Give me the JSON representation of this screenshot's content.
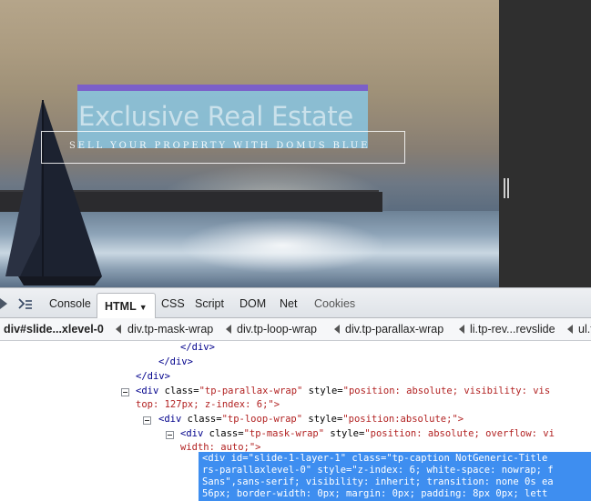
{
  "slide": {
    "title": "Exclusive Real Estate",
    "subtitle": "SELL YOUR PROPERTY WITH DOMUS BLUE",
    "highlight_color": "#89c4df",
    "highlight_border_color": "#7b5fc9"
  },
  "toolbar": {
    "tabs": [
      {
        "label": "Console",
        "active": false
      },
      {
        "label": "HTML",
        "active": true
      },
      {
        "label": "CSS",
        "active": false
      },
      {
        "label": "Script",
        "active": false
      },
      {
        "label": "DOM",
        "active": false
      },
      {
        "label": "Net",
        "active": false
      },
      {
        "label": "Cookies",
        "active": false
      }
    ],
    "icons": [
      "inspect-icon",
      "command-line-icon"
    ]
  },
  "breadcrumbs": [
    "div#slide...xlevel-0",
    "div.tp-mask-wrap",
    "div.tp-loop-wrap",
    "div.tp-parallax-wrap",
    "li.tp-rev...revslide",
    "ul.t"
  ],
  "tree": {
    "lines": [
      {
        "text": "</div>"
      },
      {
        "text": "</div>"
      },
      {
        "text": "</div>"
      },
      {
        "open": "<div",
        "attr": " class=",
        "val": "\"tp-parallax-wrap\"",
        "attr2": " style=",
        "val2": "\"position: absolute; visibility: vis"
      },
      {
        "cont": "top: 127px; z-index: 6;\">"
      },
      {
        "open": "<div",
        "attr": " class=",
        "val": "\"tp-loop-wrap\"",
        "attr2": " style=",
        "val2": "\"position:absolute;\">"
      },
      {
        "open": "<div",
        "attr": " class=",
        "val": "\"tp-mask-wrap\"",
        "attr2": " style=",
        "val2": "\"position: absolute; overflow: vi"
      },
      {
        "cont": "width: auto;\">"
      },
      {
        "text": "<div id=\"slide-1-layer-1\" class=\"tp-caption NotGeneric-Title"
      },
      {
        "text": "rs-parallaxlevel-0\" style=\"z-index: 6; white-space: nowrap; f"
      },
      {
        "text": "Sans\",sans-serif; visibility: inherit; transition: none 0s ea"
      },
      {
        "text": "56px; border-width: 0px; margin: 0px; padding: 8px 0px; lett"
      }
    ]
  },
  "colors": {
    "selection": "#3e8ef0",
    "tag": "#00008b",
    "value": "#b22222"
  }
}
